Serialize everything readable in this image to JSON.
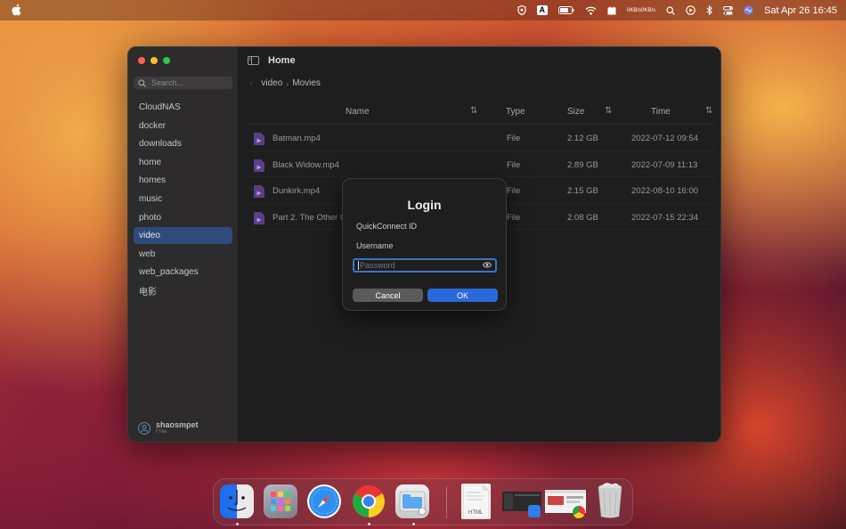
{
  "menubar": {
    "network_up": "0KB/s",
    "network_down": "0KB/s",
    "input_source": "A",
    "datetime": "Sat Apr 26  16:45"
  },
  "window": {
    "title": "Home",
    "sidebar": {
      "search_placeholder": "Search...",
      "items": [
        {
          "label": "CloudNAS"
        },
        {
          "label": "docker"
        },
        {
          "label": "downloads"
        },
        {
          "label": "home"
        },
        {
          "label": "homes"
        },
        {
          "label": "music"
        },
        {
          "label": "photo"
        },
        {
          "label": "video",
          "active": true
        },
        {
          "label": "web"
        },
        {
          "label": "web_packages"
        },
        {
          "label": "电影"
        }
      ],
      "user": {
        "name": "shaosmpet",
        "role": "Free"
      }
    },
    "breadcrumb": [
      "video",
      "Movies"
    ],
    "table": {
      "headers": {
        "name": "Name",
        "type": "Type",
        "size": "Size",
        "time": "Time"
      },
      "rows": [
        {
          "name": "Batman.mp4",
          "type": "File",
          "size": "2.12 GB",
          "time": "2022-07-12 09:54"
        },
        {
          "name": "Black Widow.mp4",
          "type": "File",
          "size": "2.89 GB",
          "time": "2022-07-09 11:13"
        },
        {
          "name": "Dunkirk.mp4",
          "type": "File",
          "size": "2.15 GB",
          "time": "2022-08-10 16:00"
        },
        {
          "name": "Part 2. The Other C",
          "type": "File",
          "size": "2.08 GB",
          "time": "2022-07-15 22:34"
        }
      ]
    }
  },
  "dialog": {
    "title": "Login",
    "quickconnect_label": "QuickConnect ID",
    "username_label": "Username",
    "password_placeholder": "Password",
    "cancel_label": "Cancel",
    "ok_label": "OK"
  },
  "dock": {
    "items": [
      "Finder",
      "Launchpad",
      "Safari",
      "Google Chrome",
      "Files",
      "HTML document",
      "Window thumbnail",
      "Window thumbnail",
      "Trash"
    ],
    "doc_label": "HTML"
  },
  "colors": {
    "accent": "#2b68d8",
    "sidebar_active": "#2e4a7a",
    "file_icon": "#7a4fb0"
  }
}
